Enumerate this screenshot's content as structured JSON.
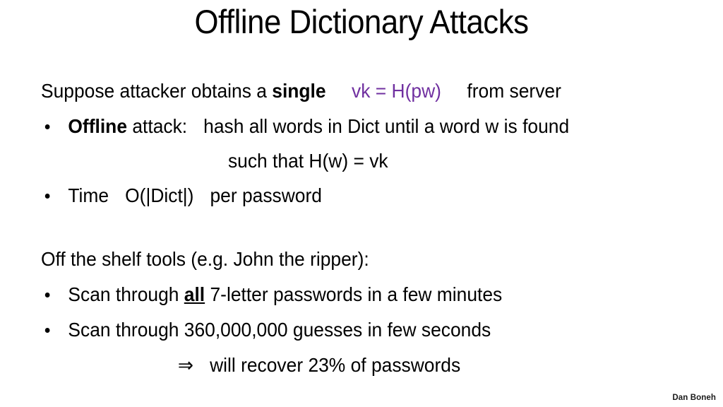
{
  "slide": {
    "title": "Offline Dictionary Attacks",
    "background_color": "#ffffff",
    "text_color": "#000000",
    "accent_color": "#7030a0",
    "block_a": {
      "intro": {
        "lead": "Suppose attacker obtains a ",
        "emphasis": "single",
        "formula": "vk  = H(pw)",
        "tail": "from server"
      },
      "bullet_offline": {
        "emphasis": "Offline",
        "rest": " attack:",
        "detail": "hash all words in Dict until a word w is found",
        "continuation": "such that   H(w) = vk"
      },
      "bullet_time": {
        "label": "Time",
        "complexity": "O(|Dict|)",
        "suffix": "per password"
      }
    },
    "block_b": {
      "heading": "Off the shelf tools  (e.g. John the ripper):",
      "bullet_scan_all": {
        "lead": "Scan through ",
        "emphasis": "all",
        "rest": "  7-letter  passwords in a few minutes"
      },
      "bullet_scan_guesses": "Scan through 360,000,000 guesses in few seconds",
      "conclusion": {
        "arrow": "⇒",
        "text": "will recover 23% of passwords"
      }
    },
    "credit": "Dan Boneh"
  }
}
